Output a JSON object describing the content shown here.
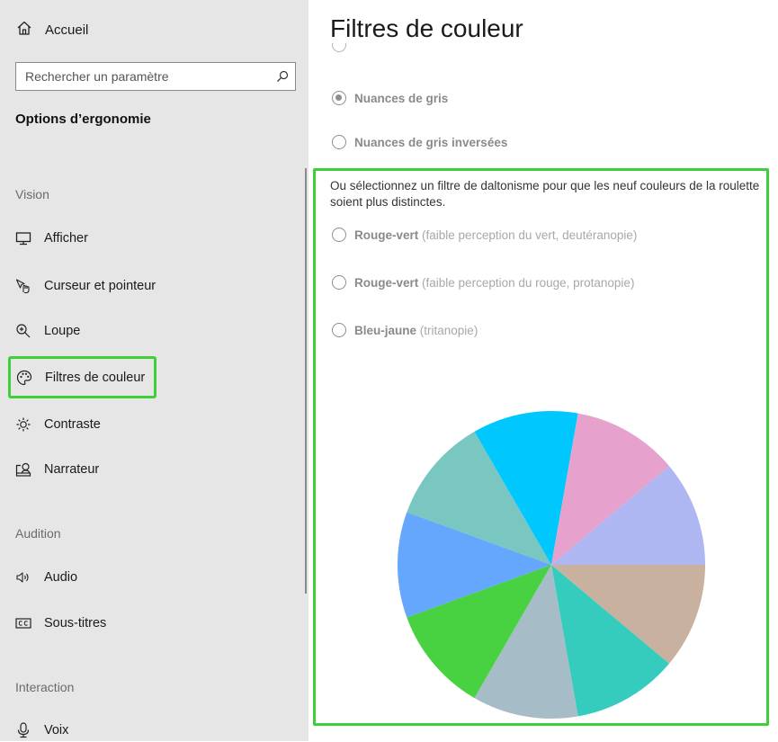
{
  "sidebar": {
    "home_label": "Accueil",
    "search_placeholder": "Rechercher un paramètre",
    "section_title": "Options d’ergonomie",
    "groups": {
      "vision": "Vision",
      "audition": "Audition",
      "interaction": "Interaction"
    },
    "items": [
      {
        "label": "Afficher",
        "icon": "monitor-icon"
      },
      {
        "label": "Curseur et pointeur",
        "icon": "pointer-icon"
      },
      {
        "label": "Loupe",
        "icon": "magnifier-icon"
      },
      {
        "label": "Filtres de couleur",
        "icon": "palette-icon",
        "selected": true
      },
      {
        "label": "Contraste",
        "icon": "sun-icon"
      },
      {
        "label": "Narrateur",
        "icon": "narrator-icon"
      },
      {
        "label": "Audio",
        "icon": "speaker-icon"
      },
      {
        "label": "Sous-titres",
        "icon": "cc-icon"
      },
      {
        "label": "Voix",
        "icon": "microphone-icon"
      }
    ]
  },
  "main": {
    "title": "Filtres de couleur",
    "radios": [
      {
        "label": "Nuances de gris",
        "sub": "",
        "checked": true
      },
      {
        "label": "Nuances de gris inversées",
        "sub": "",
        "checked": false
      }
    ],
    "description": "Ou sélectionnez un filtre de daltonisme pour que les neuf couleurs de la roulette soient plus distinctes.",
    "colorblind_filters": [
      {
        "label": "Rouge-vert",
        "sub": "(faible perception du vert, deutéranopie)",
        "checked": false
      },
      {
        "label": "Rouge-vert",
        "sub": "(faible perception du rouge, protanopie)",
        "checked": false
      },
      {
        "label": "Bleu-jaune",
        "sub": "(tritanopie)",
        "checked": false
      }
    ],
    "color_wheel": {
      "slices": [
        "#AEB7F2",
        "#C9B19F",
        "#35CCBE",
        "#A6BCC6",
        "#48D141",
        "#64A7FC",
        "#7AC6C1",
        "#00C8FE",
        "#E6A2CC"
      ]
    }
  },
  "colors": {
    "highlight": "#3ECF3A",
    "sidebar_bg": "#E6E6E6"
  }
}
